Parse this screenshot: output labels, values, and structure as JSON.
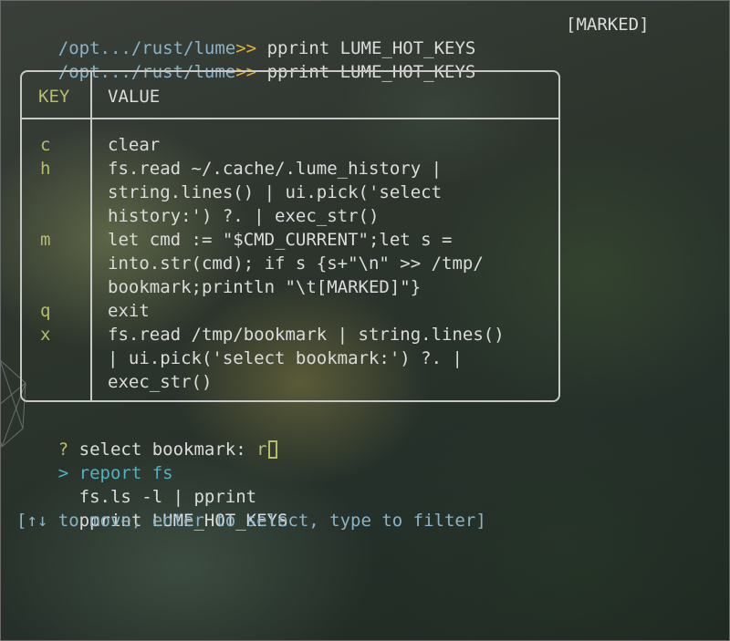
{
  "prompt_lines": [
    {
      "cwd": "/opt.../rust/lume",
      "arrow": ">>",
      "command": " pprint LUME_HOT_KEYS"
    },
    {
      "cwd": "/opt.../rust/lume",
      "arrow": ">>",
      "command": " pprint LUME_HOT_KEYS"
    }
  ],
  "marked_label": "[MARKED]",
  "table": {
    "headers": {
      "key": "KEY",
      "value": "VALUE"
    },
    "rows": [
      {
        "key": "c",
        "value_lines": [
          "clear"
        ]
      },
      {
        "key": "h",
        "value_lines": [
          "fs.read ~/.cache/.lume_history |",
          "string.lines() | ui.pick('select",
          "history:') ?. | exec_str()"
        ]
      },
      {
        "key": "m",
        "value_lines": [
          "let cmd := \"$CMD_CURRENT\";let s =",
          "into.str(cmd); if s {s+\"\\n\" >> /tmp/",
          "bookmark;println \"\\t[MARKED]\"}"
        ]
      },
      {
        "key": "q",
        "value_lines": [
          "exit"
        ]
      },
      {
        "key": "x",
        "value_lines": [
          "fs.read /tmp/bookmark | string.lines()",
          "| ui.pick('select bookmark:') ?. |",
          "exec_str()"
        ]
      }
    ]
  },
  "picker": {
    "question_mark": "?",
    "prompt": " select bookmark: ",
    "input_value": "r",
    "selector": ">",
    "options": [
      "report fs",
      "fs.ls -l | pprint",
      "pprint LUME_HOT_KEYS"
    ],
    "hint": "[↑↓ to move, enter to select, type to filter]"
  },
  "colors": {
    "cwd": "#8ab4c8",
    "arrow": "#e2b23d",
    "key": "#b7be6a",
    "selected": "#4fb3c4"
  }
}
